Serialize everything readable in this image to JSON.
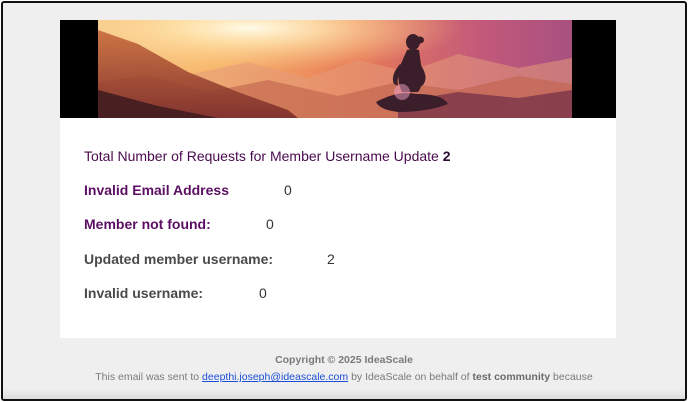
{
  "email": {
    "hero_image": "meditation-sunset-banner",
    "summary": {
      "total_label": "Total Number of Requests for Member Username Update",
      "total_value": "2"
    },
    "stats": [
      {
        "label": "Invalid Email Address",
        "value": "0"
      },
      {
        "label": "Member not found:",
        "value": "0"
      },
      {
        "label": "Updated member username:",
        "value": "2"
      },
      {
        "label": "Invalid username:",
        "value": "0"
      }
    ],
    "footer": {
      "copyright": "Copyright © 2025 IdeaScale",
      "sent_prefix": "This email was sent to",
      "email_link": "deepthi.joseph@ideascale.com",
      "sent_middle": "by IdeaScale on behalf of",
      "community": "test community",
      "sent_suffix": "because"
    }
  },
  "colors": {
    "label_purple": "#5b0f63",
    "label_dark": "#4a4a4a",
    "page_background": "#efefef",
    "link": "#1a4fd6"
  }
}
